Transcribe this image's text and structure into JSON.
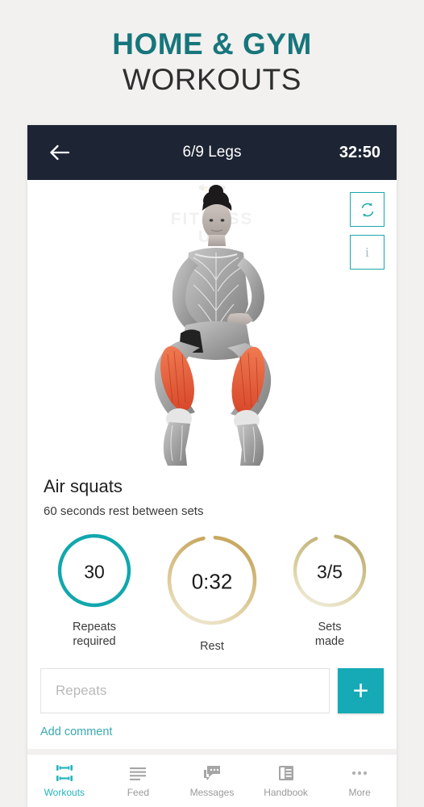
{
  "promo": {
    "line1": "HOME & GYM",
    "line2": "WORKOUTS",
    "accent_color": "#17767c",
    "dark_color": "#2e2e2e"
  },
  "appbar": {
    "back_icon": "arrow-left-icon",
    "title": "6/9 Legs",
    "timer": "32:50",
    "background": "#1d2433"
  },
  "illustration": {
    "watermark_line1": "FITNESS",
    "watermark_line2": "UA",
    "side_buttons": [
      {
        "name": "swap-exercise-button",
        "icon": "refresh-icon"
      },
      {
        "name": "exercise-info-button",
        "icon": "info-icon",
        "label": "i"
      }
    ],
    "alt": "Anatomical figure performing air squat with quadriceps highlighted",
    "highlight_color": "#e8633a"
  },
  "exercise": {
    "title": "Air squats",
    "subtitle": "60 seconds rest between sets"
  },
  "stats": [
    {
      "value": "30",
      "label_line1": "Repeats",
      "label_line2": "required",
      "ring_color": "#11a7ae",
      "ring_progress": 100,
      "name": "repeats-required-stat"
    },
    {
      "value": "0:32",
      "label_line1": "Rest",
      "label_line2": "",
      "ring_color": "#c9a961",
      "ring_progress": 62,
      "name": "rest-timer-stat"
    },
    {
      "value": "3/5",
      "label_line1": "Sets",
      "label_line2": "made",
      "ring_color": "#bdae72",
      "ring_progress": 60,
      "name": "sets-made-stat"
    }
  ],
  "comment": {
    "input_placeholder": "Repeats",
    "input_value": "",
    "add_button_label": "+",
    "add_button_color": "#15aab5",
    "add_comment_link": "Add comment",
    "link_color": "#3aa9b0"
  },
  "bottom_nav": {
    "active_color": "#27b4bd",
    "inactive_color": "#9a9a9a",
    "items": [
      {
        "label": "Workouts",
        "icon": "dumbbell-icon",
        "active": true
      },
      {
        "label": "Feed",
        "icon": "list-lines-icon",
        "active": false
      },
      {
        "label": "Messages",
        "icon": "chat-bubbles-icon",
        "active": false
      },
      {
        "label": "Handbook",
        "icon": "book-icon",
        "active": false
      },
      {
        "label": "More",
        "icon": "ellipsis-icon",
        "active": false
      }
    ]
  }
}
